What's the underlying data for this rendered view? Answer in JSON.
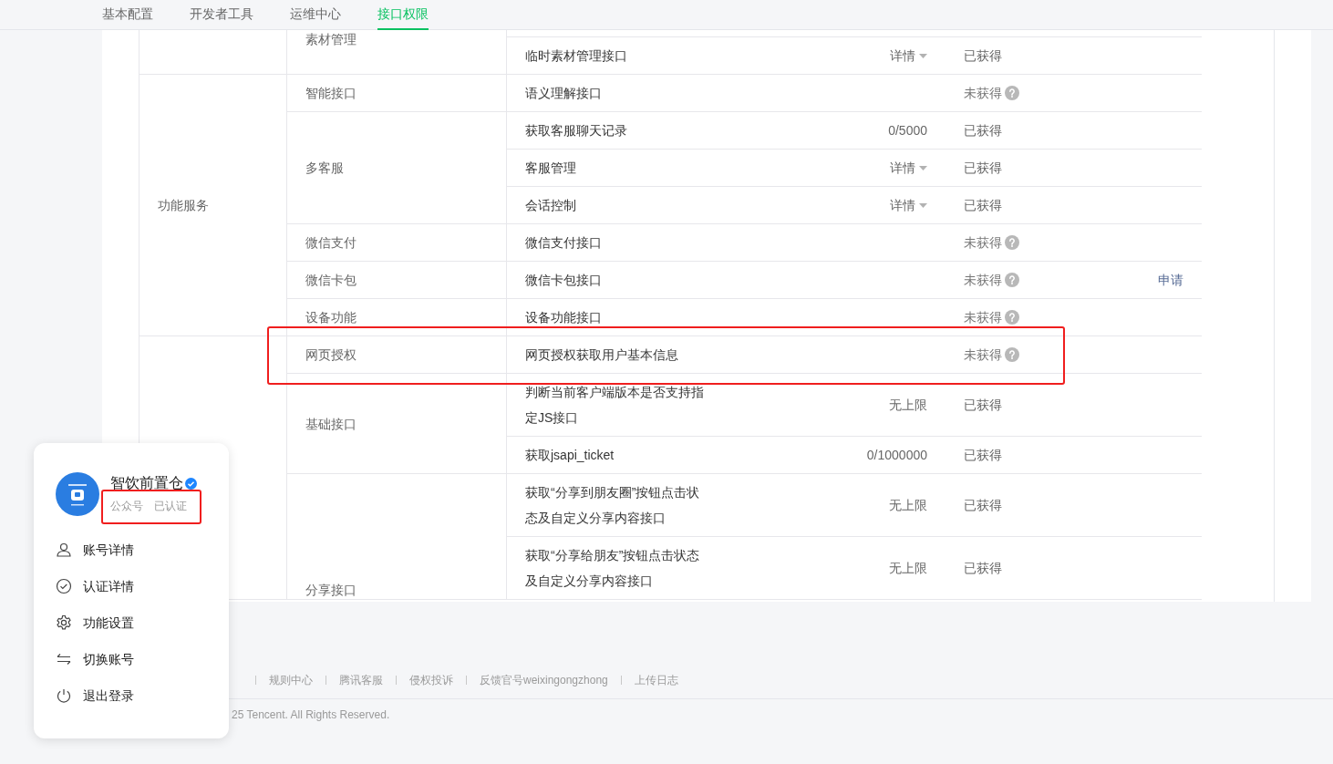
{
  "tabs": [
    {
      "label": "基本配置",
      "selected": false
    },
    {
      "label": "开发者工具",
      "selected": false
    },
    {
      "label": "运维中心",
      "selected": false
    },
    {
      "label": "接口权限",
      "selected": true
    }
  ],
  "permissions": {
    "categories": [
      {
        "subgroups": [
          {
            "label": "素材管理",
            "items": [
              {
                "name": "临时素材管理接口",
                "quota": {
                  "kind": "dropdown",
                  "text": "详情"
                },
                "status": "已获得",
                "obtained": true
              }
            ]
          }
        ]
      },
      {
        "label": "功能服务",
        "subgroups": [
          {
            "label": "智能接口",
            "items": [
              {
                "name": "语义理解接口",
                "status": "未获得",
                "obtained": false
              }
            ]
          },
          {
            "label": "多客服",
            "items": [
              {
                "name": "获取客服聊天记录",
                "quota": {
                  "kind": "text",
                  "text": "0/5000"
                },
                "status": "已获得",
                "obtained": true
              },
              {
                "name": "客服管理",
                "quota": {
                  "kind": "dropdown",
                  "text": "详情"
                },
                "status": "已获得",
                "obtained": true
              },
              {
                "name": "会话控制",
                "quota": {
                  "kind": "dropdown",
                  "text": "详情"
                },
                "status": "已获得",
                "obtained": true
              }
            ]
          },
          {
            "label": "微信支付",
            "items": [
              {
                "name": "微信支付接口",
                "status": "未获得",
                "obtained": false
              }
            ]
          },
          {
            "label": "微信卡包",
            "items": [
              {
                "name": "微信卡包接口",
                "status": "未获得",
                "obtained": false,
                "action": "申请"
              }
            ]
          },
          {
            "label": "设备功能",
            "items": [
              {
                "name": "设备功能接口",
                "status": "未获得",
                "obtained": false
              }
            ]
          }
        ]
      },
      {
        "subgroups": [
          {
            "label": "网页授权",
            "items": [
              {
                "name": "网页授权获取用户基本信息",
                "status": "未获得",
                "obtained": false
              }
            ]
          },
          {
            "label": "基础接口",
            "items": [
              {
                "name": "判断当前客户端版本是否支持指定JS接口",
                "quota": {
                  "kind": "text",
                  "text": "无上限"
                },
                "status": "已获得",
                "obtained": true
              },
              {
                "name": "获取jsapi_ticket",
                "quota": {
                  "kind": "text",
                  "text": "0/1000000"
                },
                "status": "已获得",
                "obtained": true
              }
            ]
          },
          {
            "label": "分享接口",
            "items": [
              {
                "name": "获取“分享到朋友圈”按钮点击状态及自定义分享内容接口",
                "quota": {
                  "kind": "text",
                  "text": "无上限"
                },
                "status": "已获得",
                "obtained": true
              },
              {
                "name": "获取“分享给朋友”按钮点击状态及自定义分享内容接口",
                "quota": {
                  "kind": "text",
                  "text": "无上限"
                },
                "status": "已获得",
                "obtained": true
              }
            ]
          }
        ]
      }
    ]
  },
  "account_popup": {
    "name": "智饮前置仓",
    "verified": true,
    "type": "公众号",
    "status": "已认证",
    "menu": [
      {
        "label": "账号详情"
      },
      {
        "label": "认证详情"
      },
      {
        "label": "功能设置"
      },
      {
        "label": "切换账号"
      },
      {
        "label": "退出登录"
      }
    ]
  },
  "footer": {
    "links": [
      "规则中心",
      "腾讯客服",
      "侵权投诉",
      "反馈官号weixingongzhong",
      "上传日志"
    ],
    "copyright": "25 Tencent. All Rights Reserved."
  }
}
